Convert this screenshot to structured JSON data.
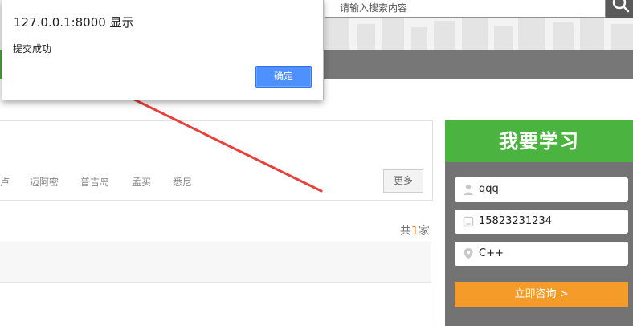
{
  "header": {
    "search_placeholder": "请输入搜索内容"
  },
  "filter": {
    "cities": [
      "卢",
      "迈阿密",
      "普吉岛",
      "孟买",
      "悉尼"
    ],
    "more_label": "更多"
  },
  "results": {
    "total_prefix": "共",
    "total_count": "1",
    "total_suffix": "家"
  },
  "sidebar": {
    "title": "我要学习",
    "name_value": "qqq",
    "phone_value": "15823231234",
    "course_value": "C++",
    "submit_label": "立即咨询 >"
  },
  "dialog": {
    "title": "127.0.0.1:8000 显示",
    "message": "提交成功",
    "ok_label": "确定"
  },
  "colors": {
    "sidebar_green": "#4bb33f",
    "submit_orange": "#f59b2a",
    "dialog_button_blue": "#4d90fe",
    "arrow_red": "#e8403a"
  }
}
